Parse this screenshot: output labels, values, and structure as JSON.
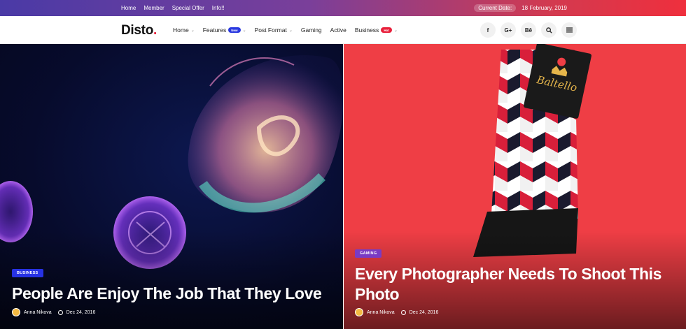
{
  "topbar": {
    "links": [
      "Home",
      "Member",
      "Special Offer",
      "Info!!"
    ],
    "date_label": "Current Date:",
    "date_value": "18 February, 2019"
  },
  "header": {
    "logo": "Disto",
    "logo_dot": ".",
    "nav": [
      {
        "label": "Home",
        "has_caret": true
      },
      {
        "label": "Features",
        "badge": "New",
        "has_caret": true
      },
      {
        "label": "Post Format",
        "has_caret": true
      },
      {
        "label": "Gaming"
      },
      {
        "label": "Active"
      },
      {
        "label": "Business",
        "badge": "Hot",
        "has_caret": true
      }
    ],
    "social": [
      "f",
      "G+",
      "Bē"
    ]
  },
  "posts": [
    {
      "category": "BUSINESS",
      "title": "People Are Enjoy The Job That They Love",
      "author": "Anna Nikova",
      "date": "Dec 24, 2016"
    },
    {
      "category": "GAMING",
      "title_line1": "Every Photographer Needs To Shoot This",
      "title_line2": "Photo",
      "author": "Anna Nikova",
      "date": "Dec 24, 2016"
    }
  ],
  "colors": {
    "accent_red": "#e8203b",
    "accent_blue": "#2732e3",
    "accent_purple": "#7a3bc4"
  }
}
